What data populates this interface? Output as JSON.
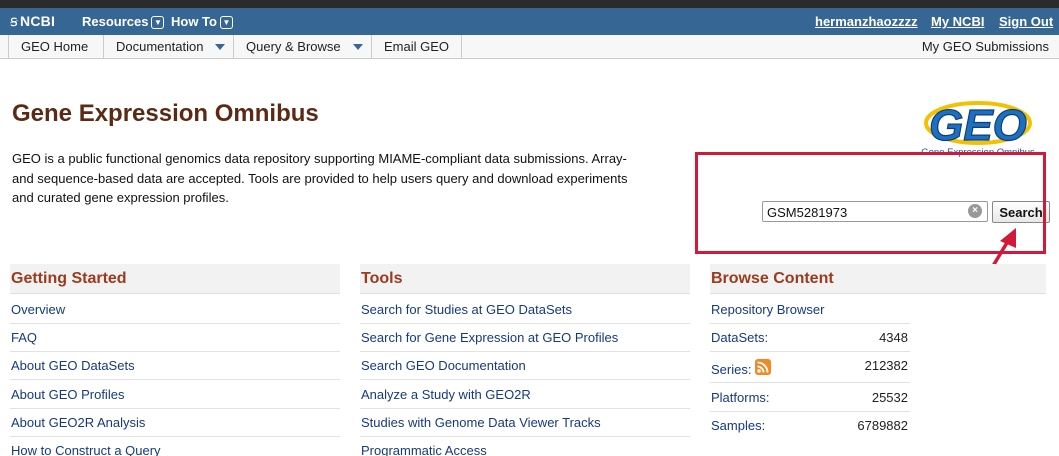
{
  "ncbi_bar": {
    "logo": "NCBI",
    "resources": "Resources",
    "howto": "How To",
    "username": "hermanzhaozzzz",
    "my_ncbi": "My NCBI",
    "sign_out": "Sign Out"
  },
  "geo_nav": {
    "home": "GEO Home",
    "documentation": "Documentation",
    "query_browse": "Query & Browse",
    "email": "Email GEO",
    "submissions": "My GEO Submissions"
  },
  "page": {
    "title": "Gene Expression Omnibus",
    "intro": "GEO is a public functional genomics data repository supporting MIAME-compliant data submissions. Array- and sequence-based data are accepted. Tools are provided to help users query and download experiments and curated gene expression profiles."
  },
  "logo": {
    "letters": "GEO",
    "tagline": "Gene Expression Omnibus"
  },
  "search": {
    "value": "GSM5281973",
    "button": "Search"
  },
  "getting_started": {
    "heading": "Getting Started",
    "items": [
      "Overview",
      "FAQ",
      "About GEO DataSets",
      "About GEO Profiles",
      "About GEO2R Analysis",
      "How to Construct a Query"
    ]
  },
  "tools": {
    "heading": "Tools",
    "items": [
      "Search for Studies at GEO DataSets",
      "Search for Gene Expression at GEO Profiles",
      "Search GEO Documentation",
      "Analyze a Study with GEO2R",
      "Studies with Genome Data Viewer Tracks",
      "Programmatic Access"
    ]
  },
  "browse": {
    "heading": "Browse Content",
    "repository": "Repository Browser",
    "stats": [
      {
        "label": "DataSets:",
        "value": "4348"
      },
      {
        "label": "Series:",
        "value": "212382"
      },
      {
        "label": "Platforms:",
        "value": "25532"
      },
      {
        "label": "Samples:",
        "value": "6789882"
      }
    ]
  },
  "colors": {
    "ncbi_bar": "#366693",
    "heading": "#5c2a14",
    "section_heading": "#9a3b1e",
    "link": "#153a80",
    "annotation": "#d11a3a"
  },
  "icons": [
    "ncbi-logo-icon",
    "chevron-down-icon",
    "caret-down-icon",
    "clear-icon",
    "rss-icon",
    "geo-logo"
  ]
}
